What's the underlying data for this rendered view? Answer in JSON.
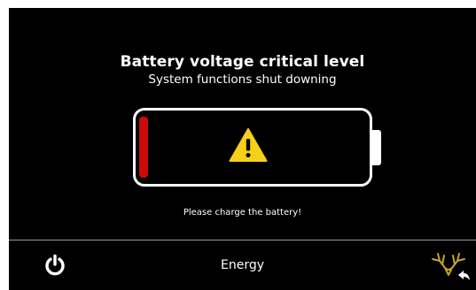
{
  "alert": {
    "title": "Battery voltage critical level",
    "subtitle": "System functions shut downing",
    "message": "Please charge the battery!"
  },
  "battery": {
    "level": 0.04,
    "fill_color": "#cc0a0a",
    "outline_color": "#ffffff",
    "status_icon": "warning-icon",
    "warning_color": "#f7d117"
  },
  "footer": {
    "left_icon": "power-icon",
    "title": "Energy",
    "right_icon": "deer-logo-back-icon",
    "logo_color": "#c9a227"
  },
  "colors": {
    "background": "#000000",
    "text": "#ffffff",
    "divider": "#9a9a9a"
  }
}
